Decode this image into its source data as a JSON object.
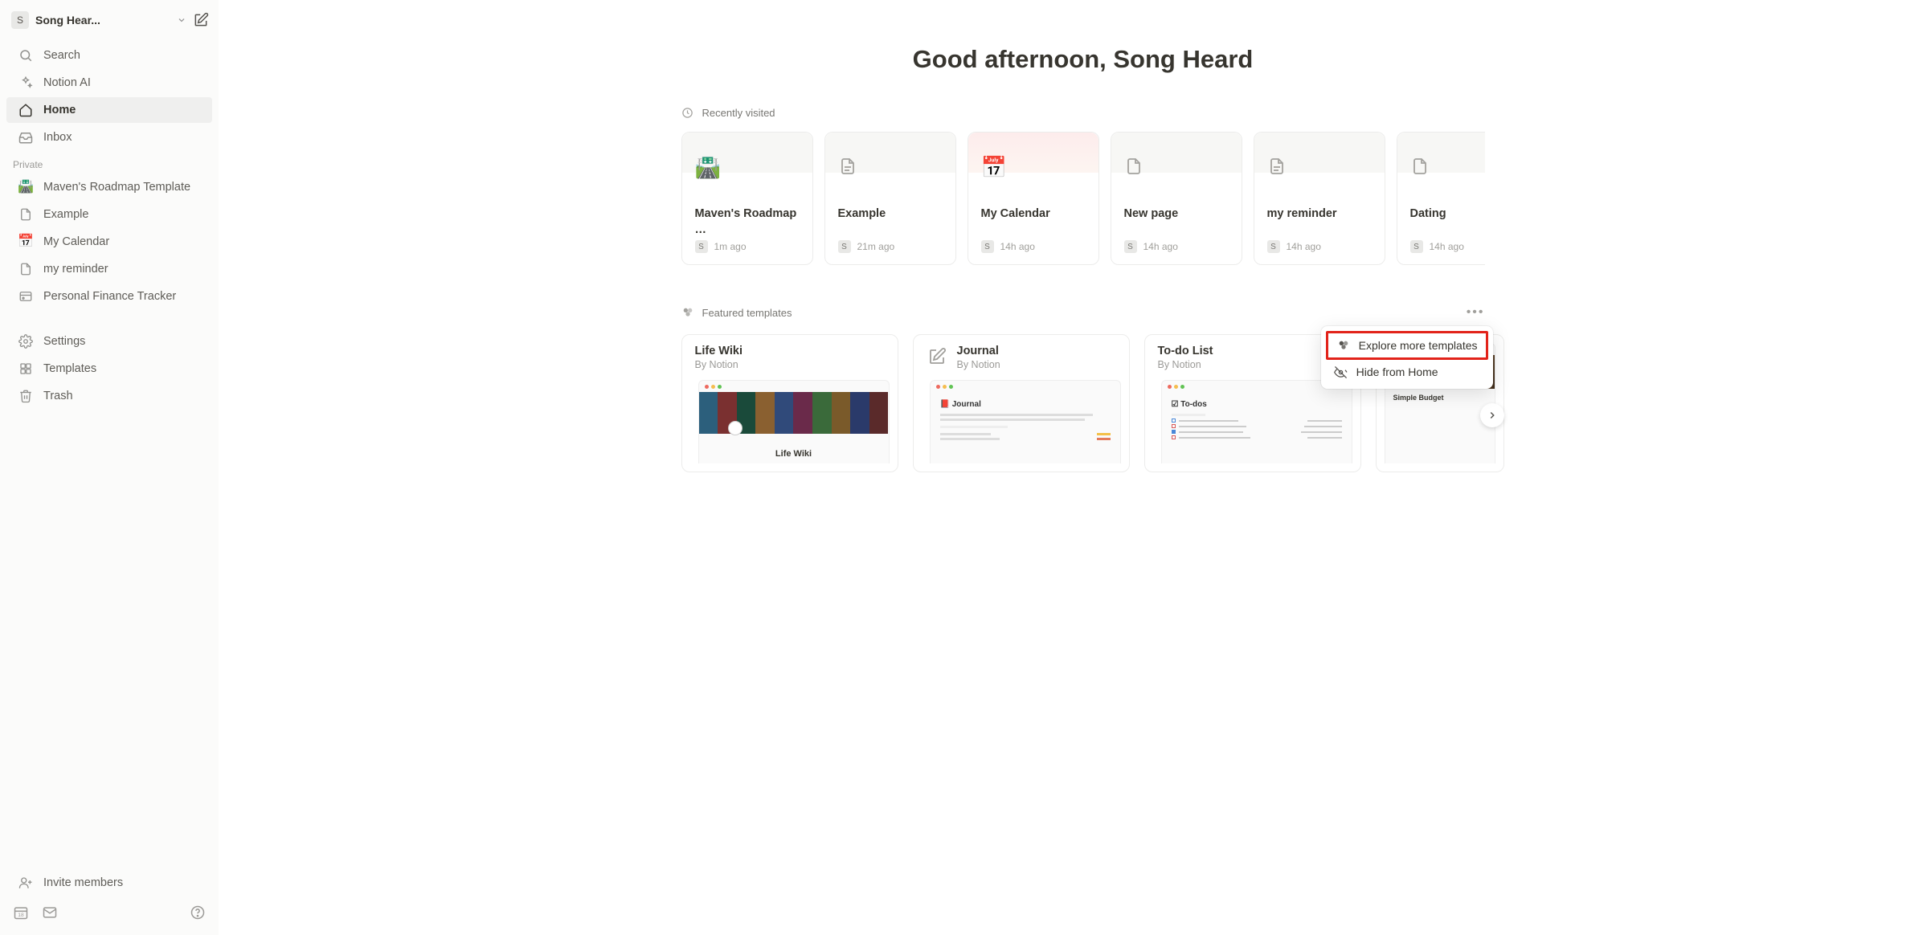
{
  "workspace": {
    "avatar_letter": "S",
    "name": "Song Hear..."
  },
  "sidebar": {
    "search": "Search",
    "ai": "Notion AI",
    "home": "Home",
    "inbox": "Inbox",
    "section_private": "Private",
    "pages": {
      "roadmap": "Maven's Roadmap Template",
      "example": "Example",
      "calendar": "My Calendar",
      "reminder": "my reminder",
      "finance": "Personal Finance Tracker"
    },
    "settings": "Settings",
    "templates": "Templates",
    "trash": "Trash",
    "invite": "Invite members"
  },
  "greeting": "Good afternoon, Song Heard",
  "recent": {
    "label": "Recently visited",
    "items": [
      {
        "title": "Maven's Roadmap …",
        "ago": "1m ago",
        "avatar": "S"
      },
      {
        "title": "Example",
        "ago": "21m ago",
        "avatar": "S"
      },
      {
        "title": "My Calendar",
        "ago": "14h ago",
        "avatar": "S"
      },
      {
        "title": "New page",
        "ago": "14h ago",
        "avatar": "S"
      },
      {
        "title": "my reminder",
        "ago": "14h ago",
        "avatar": "S"
      },
      {
        "title": "Dating",
        "ago": "14h ago",
        "avatar": "S"
      }
    ]
  },
  "featured": {
    "label": "Featured templates",
    "by_notion": "By Notion",
    "items": [
      {
        "title": "Life Wiki"
      },
      {
        "title": "Journal"
      },
      {
        "title": "To-do List"
      },
      {
        "title": "Simple Budget"
      }
    ],
    "preview_lifewiki": "Life Wiki",
    "preview_journal_title": "📕 Journal",
    "preview_todos_title": "☑ To-dos"
  },
  "menu": {
    "explore": "Explore more templates",
    "hide": "Hide from Home"
  }
}
